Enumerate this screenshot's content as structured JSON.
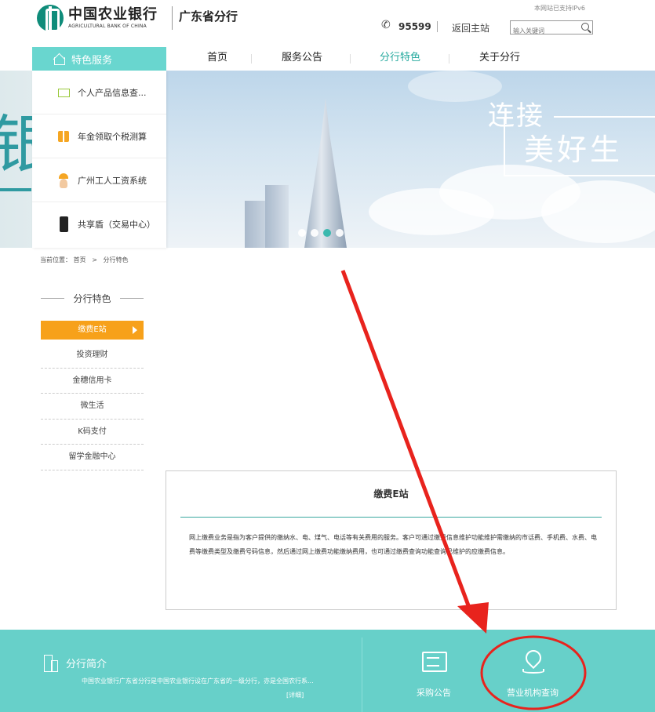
{
  "header": {
    "logo_cn": "中国农业银行",
    "logo_en": "AGRICULTURAL BANK OF CHINA",
    "branch": "广东省分行",
    "ipv6_notice": "本网站已支持IPv6",
    "hotline": "95599",
    "back_home": "返回主站",
    "search_placeholder": "输入关键词"
  },
  "nav": {
    "feature_label": "特色服务",
    "items": [
      "首页",
      "服务公告",
      "分行特色",
      "关于分行"
    ],
    "active_item": "分行特色"
  },
  "dropdown": {
    "items": [
      {
        "label": "个人产品信息查...",
        "icon": "monitor-icon"
      },
      {
        "label": "年金领取个税测算",
        "icon": "calculator-icon"
      },
      {
        "label": "广州工人工资系统",
        "icon": "worker-icon"
      },
      {
        "label": "共享盾（交易中心）",
        "icon": "phone-icon"
      }
    ]
  },
  "banner": {
    "slogan_line1": "连接",
    "slogan_line2": "美好生",
    "left_char": "银",
    "slide_count": 4,
    "active_slide": 3
  },
  "breadcrumb": {
    "prefix": "当前位置：",
    "home": "首页",
    "sep": ">",
    "current": "分行特色"
  },
  "sidebar": {
    "title": "分行特色",
    "items": [
      "缴费E站",
      "投资理财",
      "金穗信用卡",
      "微生活",
      "K码支付",
      "留学金融中心"
    ],
    "active": "缴费E站"
  },
  "content": {
    "title": "缴费E站",
    "body": "网上缴费业务是指为客户提供的缴纳水、电、煤气、电话等有关费用的服务。客户可通过缴费信息维护功能维护需缴纳的市话费、手机费、水费、电费等缴费类型及缴费号码信息，然后通过网上缴费功能缴纳费用，也可通过缴费查询功能查询已维护的应缴费信息。"
  },
  "footer": {
    "intro_title": "分行简介",
    "intro_text": "中国农业银行广东省分行是中国农业银行设在广东省的一级分行，亦是全国农行系...",
    "detail_link": "[详细]",
    "btn_purchase": "采购公告",
    "btn_branch_query": "营业机构查询"
  },
  "colors": {
    "teal": "#67d0c9",
    "orange": "#f7a11a",
    "annotation_red": "#e8231d"
  }
}
